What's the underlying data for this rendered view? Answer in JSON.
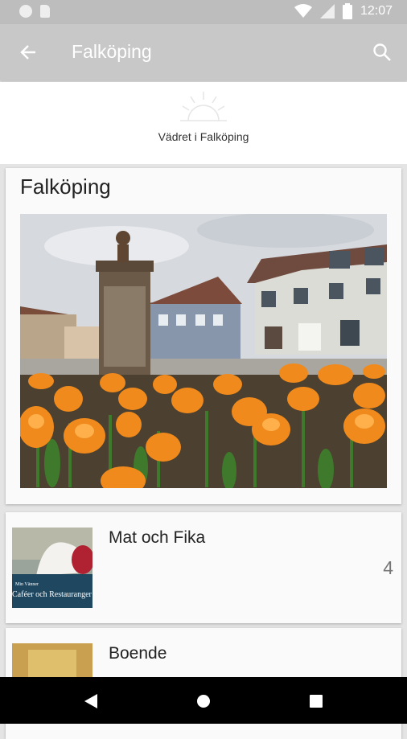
{
  "status_bar": {
    "time": "12:07"
  },
  "app_bar": {
    "title": "Falköping",
    "back_icon": "arrow-back-icon",
    "search_icon": "search-icon"
  },
  "weather": {
    "label": "Vädret i Falköping",
    "icon": "sunrise-icon"
  },
  "main_card": {
    "title": "Falköping"
  },
  "list": [
    {
      "title": "Mat och Fika",
      "count": "4",
      "thumb_caption": "Caféer och Restauranger",
      "thumb_caption_top": "Min Vänner"
    },
    {
      "title": "Boende",
      "count": ""
    }
  ],
  "nav": {
    "back": "nav-back-icon",
    "home": "nav-home-icon",
    "recents": "nav-recents-icon"
  },
  "colors": {
    "status_bar": "#bdbdbd",
    "app_bar": "#c8c8c8",
    "background": "#e4e4e4",
    "card": "#fafafa"
  }
}
